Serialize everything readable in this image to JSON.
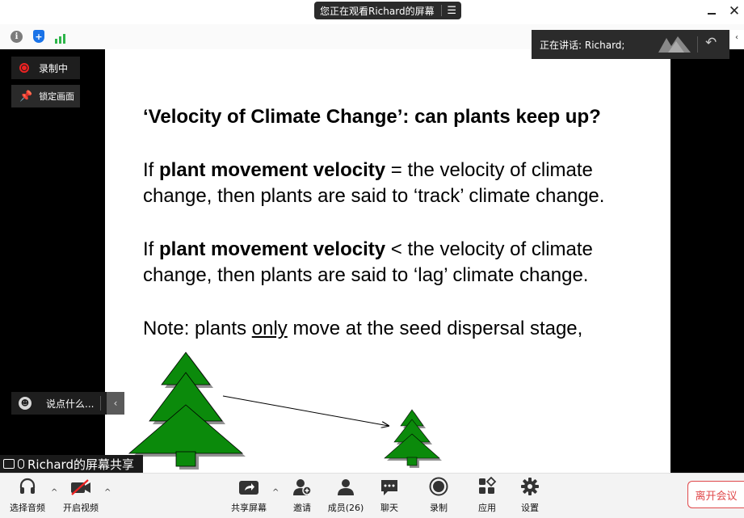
{
  "titlebar": {
    "viewing_label": "您正在观看Richard的屏幕",
    "menu_glyph": "☰",
    "close_glyph": "✕"
  },
  "iconbar": {
    "info_glyph": "i",
    "shield_glyph": "+"
  },
  "speaker": {
    "label": "正在讲话: Richard;",
    "reply_glyph": "↶",
    "edge_glyph": "‹"
  },
  "overlays": {
    "recording_label": "录制中",
    "lock_view_label": "锁定画面",
    "chat_placeholder": "说点什么...",
    "chat_collapse_glyph": "‹",
    "share_label": "Richard的屏幕共享"
  },
  "slide": {
    "title": "‘Velocity of Climate Change’: can plants keep up?",
    "p1_prefix": "If ",
    "p1_bold": "plant movement velocity",
    "p1_rest": " = the velocity of climate",
    "p1_line2": "change, then plants are said to ‘track’ climate change.",
    "p2_prefix": "If ",
    "p2_bold": "plant movement velocity",
    "p2_rest": " < the velocity of climate",
    "p2_line2": "change, then plants are said to ‘lag’ climate change.",
    "p3_prefix": "Note: plants ",
    "p3_underline": "only",
    "p3_rest": " move at the seed dispersal stage,"
  },
  "toolbar": {
    "audio": "选择音频",
    "video": "开启视频",
    "share": "共享屏幕",
    "invite": "邀请",
    "participants": "成员(26)",
    "chat": "聊天",
    "record": "录制",
    "apps": "应用",
    "settings": "设置",
    "leave": "离开会议",
    "caret_glyph": "^"
  },
  "colors": {
    "tree_green": "#0b8a0b",
    "leave_red": "#e0494b",
    "record_red": "#e22222",
    "signal_green": "#2eb54a",
    "shield_blue": "#1a73e8"
  }
}
